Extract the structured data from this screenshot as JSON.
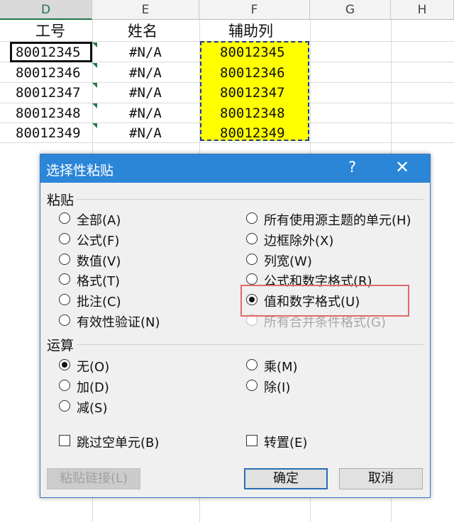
{
  "sheet": {
    "columns": [
      "D",
      "E",
      "F",
      "G",
      "H"
    ],
    "headers": {
      "d": "工号",
      "e": "姓名",
      "f": "辅助列"
    },
    "rows": [
      {
        "d": "80012345",
        "e": "#N/A",
        "f": "80012345"
      },
      {
        "d": "80012346",
        "e": "#N/A",
        "f": "80012346"
      },
      {
        "d": "80012347",
        "e": "#N/A",
        "f": "80012347"
      },
      {
        "d": "80012348",
        "e": "#N/A",
        "f": "80012348"
      },
      {
        "d": "80012349",
        "e": "#N/A",
        "f": "80012349"
      }
    ],
    "copy_highlight_color": "#ffff00"
  },
  "dialog": {
    "title": "选择性粘贴",
    "help": "?",
    "close": "✕",
    "paste_group": "粘贴",
    "paste_options_left": [
      "全部(A)",
      "公式(F)",
      "数值(V)",
      "格式(T)",
      "批注(C)",
      "有效性验证(N)"
    ],
    "paste_options_right": [
      "所有使用源主题的单元(H)",
      "边框除外(X)",
      "列宽(W)",
      "公式和数字格式(R)",
      "值和数字格式(U)",
      "所有合并条件格式(G)"
    ],
    "selected_paste": "值和数字格式(U)",
    "operation_group": "运算",
    "operation_left": [
      "无(O)",
      "加(D)",
      "减(S)"
    ],
    "operation_right": [
      "乘(M)",
      "除(I)"
    ],
    "selected_operation": "无(O)",
    "skip_blanks": "跳过空单元(B)",
    "transpose": "转置(E)",
    "paste_link": "粘贴链接(L)",
    "ok": "确定",
    "cancel": "取消",
    "accent_color": "#2b86d8"
  }
}
